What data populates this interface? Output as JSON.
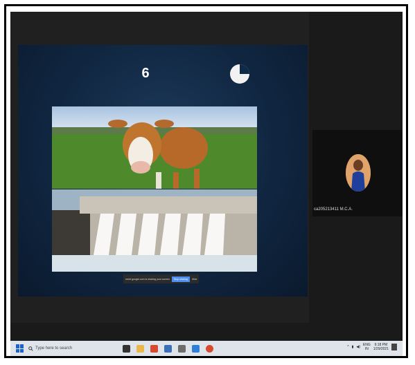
{
  "slide": {
    "number": "6"
  },
  "share_bar": {
    "message": "meet.google.com is sharing your screen",
    "stop_label": "Stop sharing",
    "hide_label": "Hide"
  },
  "participant": {
    "name": "ca205213411 M.C.A."
  },
  "taskbar": {
    "search_placeholder": "Type here to search",
    "time": "6:18 PM",
    "date": "1/29/2021",
    "lang_top": "ENG",
    "lang_bottom": "IN"
  },
  "colors": {
    "slide_bg": "#102640",
    "stop_button": "#4f8ff0",
    "taskbar": "#dfe4ea"
  }
}
